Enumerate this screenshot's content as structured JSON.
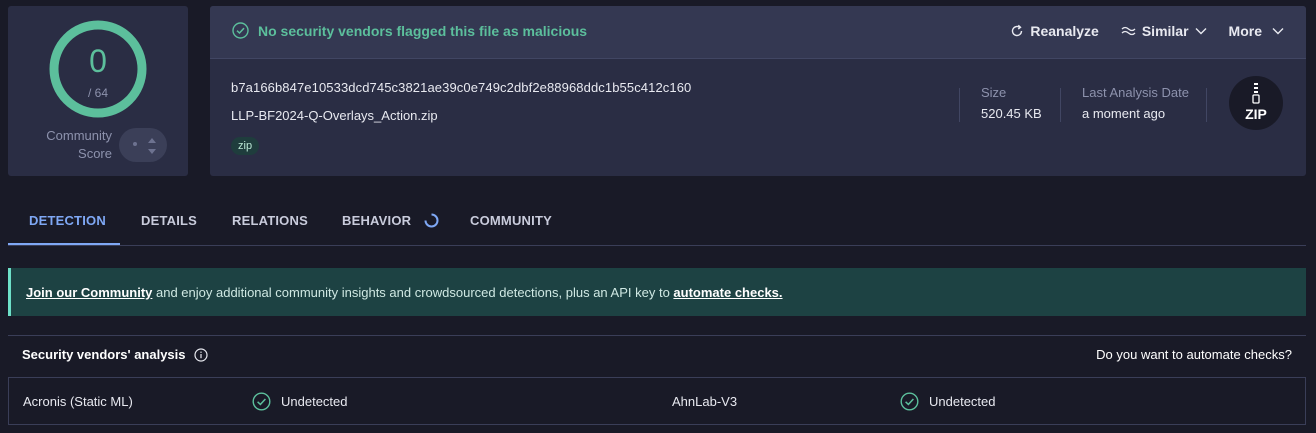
{
  "score": {
    "detections": "0",
    "total": "/ 64",
    "community_label_1": "Community",
    "community_label_2": "Score"
  },
  "header": {
    "status_text": "No security vendors flagged this file as malicious",
    "reanalyze_label": "Reanalyze",
    "similar_label": "Similar",
    "more_label": "More"
  },
  "file": {
    "hash": "b7a166b847e10533dcd745c3821ae39c0e749c2dbf2e88968ddc1b55c412c160",
    "name": "LLP-BF2024-Q-Overlays_Action.zip",
    "tag": "zip",
    "size_label": "Size",
    "size_value": "520.45 KB",
    "date_label": "Last Analysis Date",
    "date_value": "a moment ago",
    "type_badge": "ZIP"
  },
  "tabs": [
    {
      "label": "DETECTION"
    },
    {
      "label": "DETAILS"
    },
    {
      "label": "RELATIONS"
    },
    {
      "label": "BEHAVIOR"
    },
    {
      "label": "COMMUNITY"
    }
  ],
  "banner": {
    "join_link": "Join our Community",
    "middle_text": " and enjoy additional community insights and crowdsourced detections, plus an API key to ",
    "automate_link": "automate checks."
  },
  "analysis": {
    "title": "Security vendors' analysis",
    "automate_question": "Do you want to automate checks?",
    "rows": [
      {
        "vendor_left": "Acronis (Static ML)",
        "result_left": "Undetected",
        "vendor_right": "AhnLab-V3",
        "result_right": "Undetected"
      }
    ]
  },
  "colors": {
    "accent_green": "#5cbf9c",
    "tab_active": "#7fa8f5",
    "background": "#191a27",
    "card": "#2a2d44"
  }
}
